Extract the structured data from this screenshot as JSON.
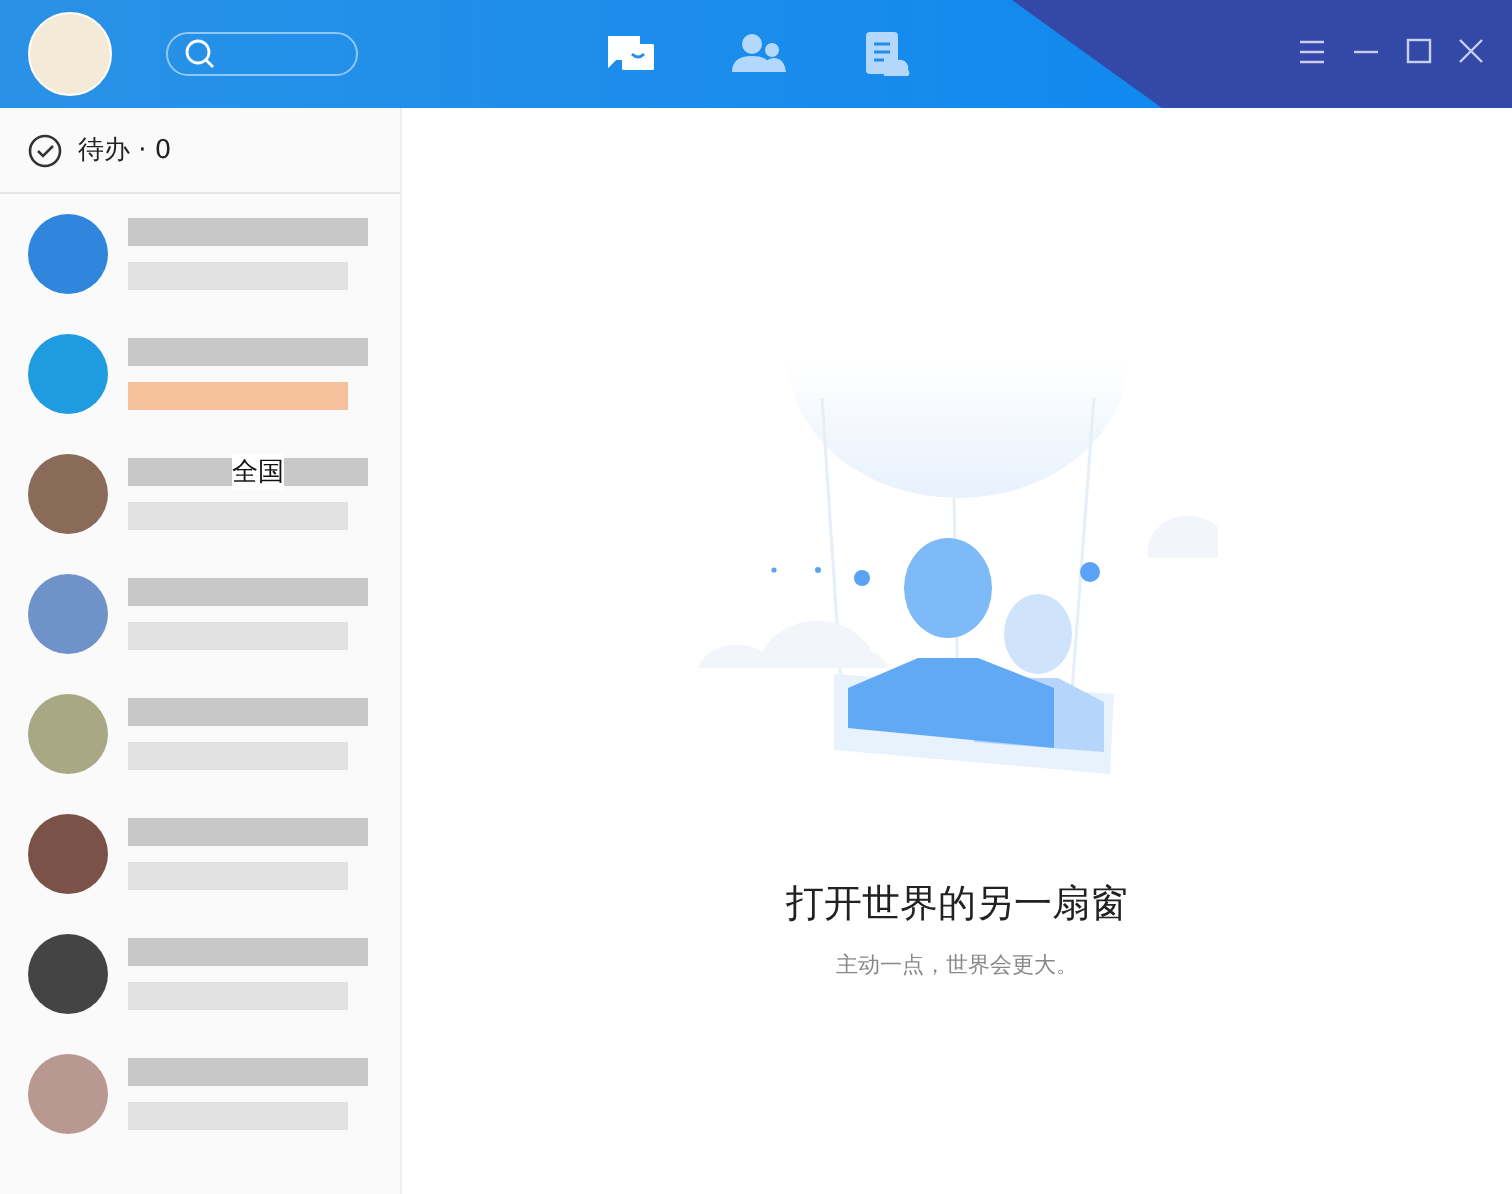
{
  "tabs": [
    {
      "kind": "chat",
      "selected": true
    },
    {
      "kind": "contacts",
      "selected": false
    },
    {
      "kind": "files",
      "selected": false
    }
  ],
  "todo": {
    "label": "待办 · 0"
  },
  "contacts": [
    {
      "color": "#2f86dc",
      "unread": false
    },
    {
      "color": "#1f9be0",
      "unread": true
    },
    {
      "color": "#8a6a58",
      "unread": false,
      "visible_text": "全国"
    },
    {
      "color": "#6f93c8",
      "unread": false
    },
    {
      "color": "#a9a884",
      "unread": false
    },
    {
      "color": "#7a5248",
      "unread": false
    },
    {
      "color": "#444444",
      "unread": false
    },
    {
      "color": "#b89890",
      "unread": false
    }
  ],
  "empty_state": {
    "title": "打开世界的另一扇窗",
    "subtitle": "主动一点，世界会更大。"
  }
}
